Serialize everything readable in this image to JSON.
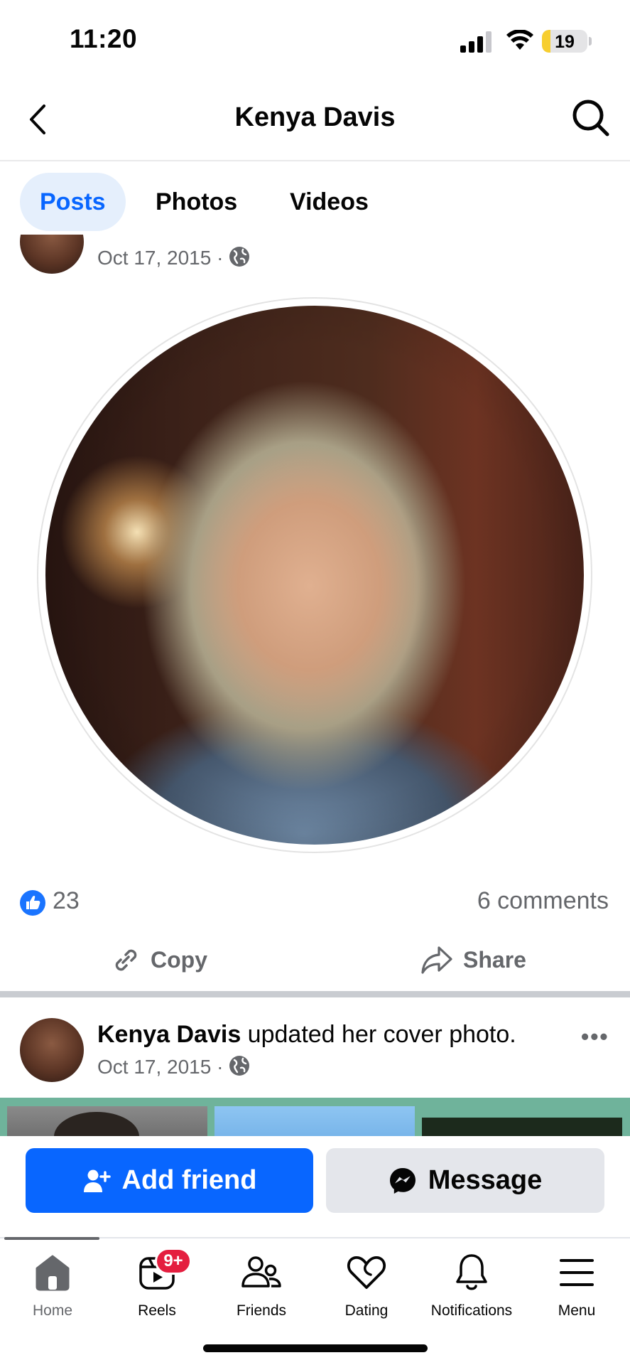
{
  "status_bar": {
    "time": "11:20",
    "battery": "19",
    "battery_level_percent": 19
  },
  "header": {
    "title": "Kenya Davis"
  },
  "tabs": [
    {
      "label": "Posts",
      "active": true
    },
    {
      "label": "Photos",
      "active": false
    },
    {
      "label": "Videos",
      "active": false
    }
  ],
  "post1": {
    "date": "Oct 17, 2015",
    "separator": "·",
    "like_count": "23",
    "comments": "6 comments",
    "actions": {
      "copy": "Copy",
      "share": "Share"
    }
  },
  "post2": {
    "author": "Kenya Davis",
    "action_text": " updated her cover photo.",
    "date": "Oct 17, 2015",
    "separator": "·",
    "more": "•••"
  },
  "profile_actions": {
    "add_friend": "Add friend",
    "message": "Message"
  },
  "bottom_nav": [
    {
      "label": "Home",
      "icon": "home-icon",
      "active": true
    },
    {
      "label": "Reels",
      "icon": "reels-icon",
      "badge": "9+"
    },
    {
      "label": "Friends",
      "icon": "friends-icon"
    },
    {
      "label": "Dating",
      "icon": "dating-icon"
    },
    {
      "label": "Notifications",
      "icon": "bell-icon"
    },
    {
      "label": "Menu",
      "icon": "menu-icon"
    }
  ],
  "colors": {
    "accent": "#0866ff",
    "badge": "#e41e3f",
    "secondary_text": "#65676b",
    "battery": "#f7ce2f"
  }
}
